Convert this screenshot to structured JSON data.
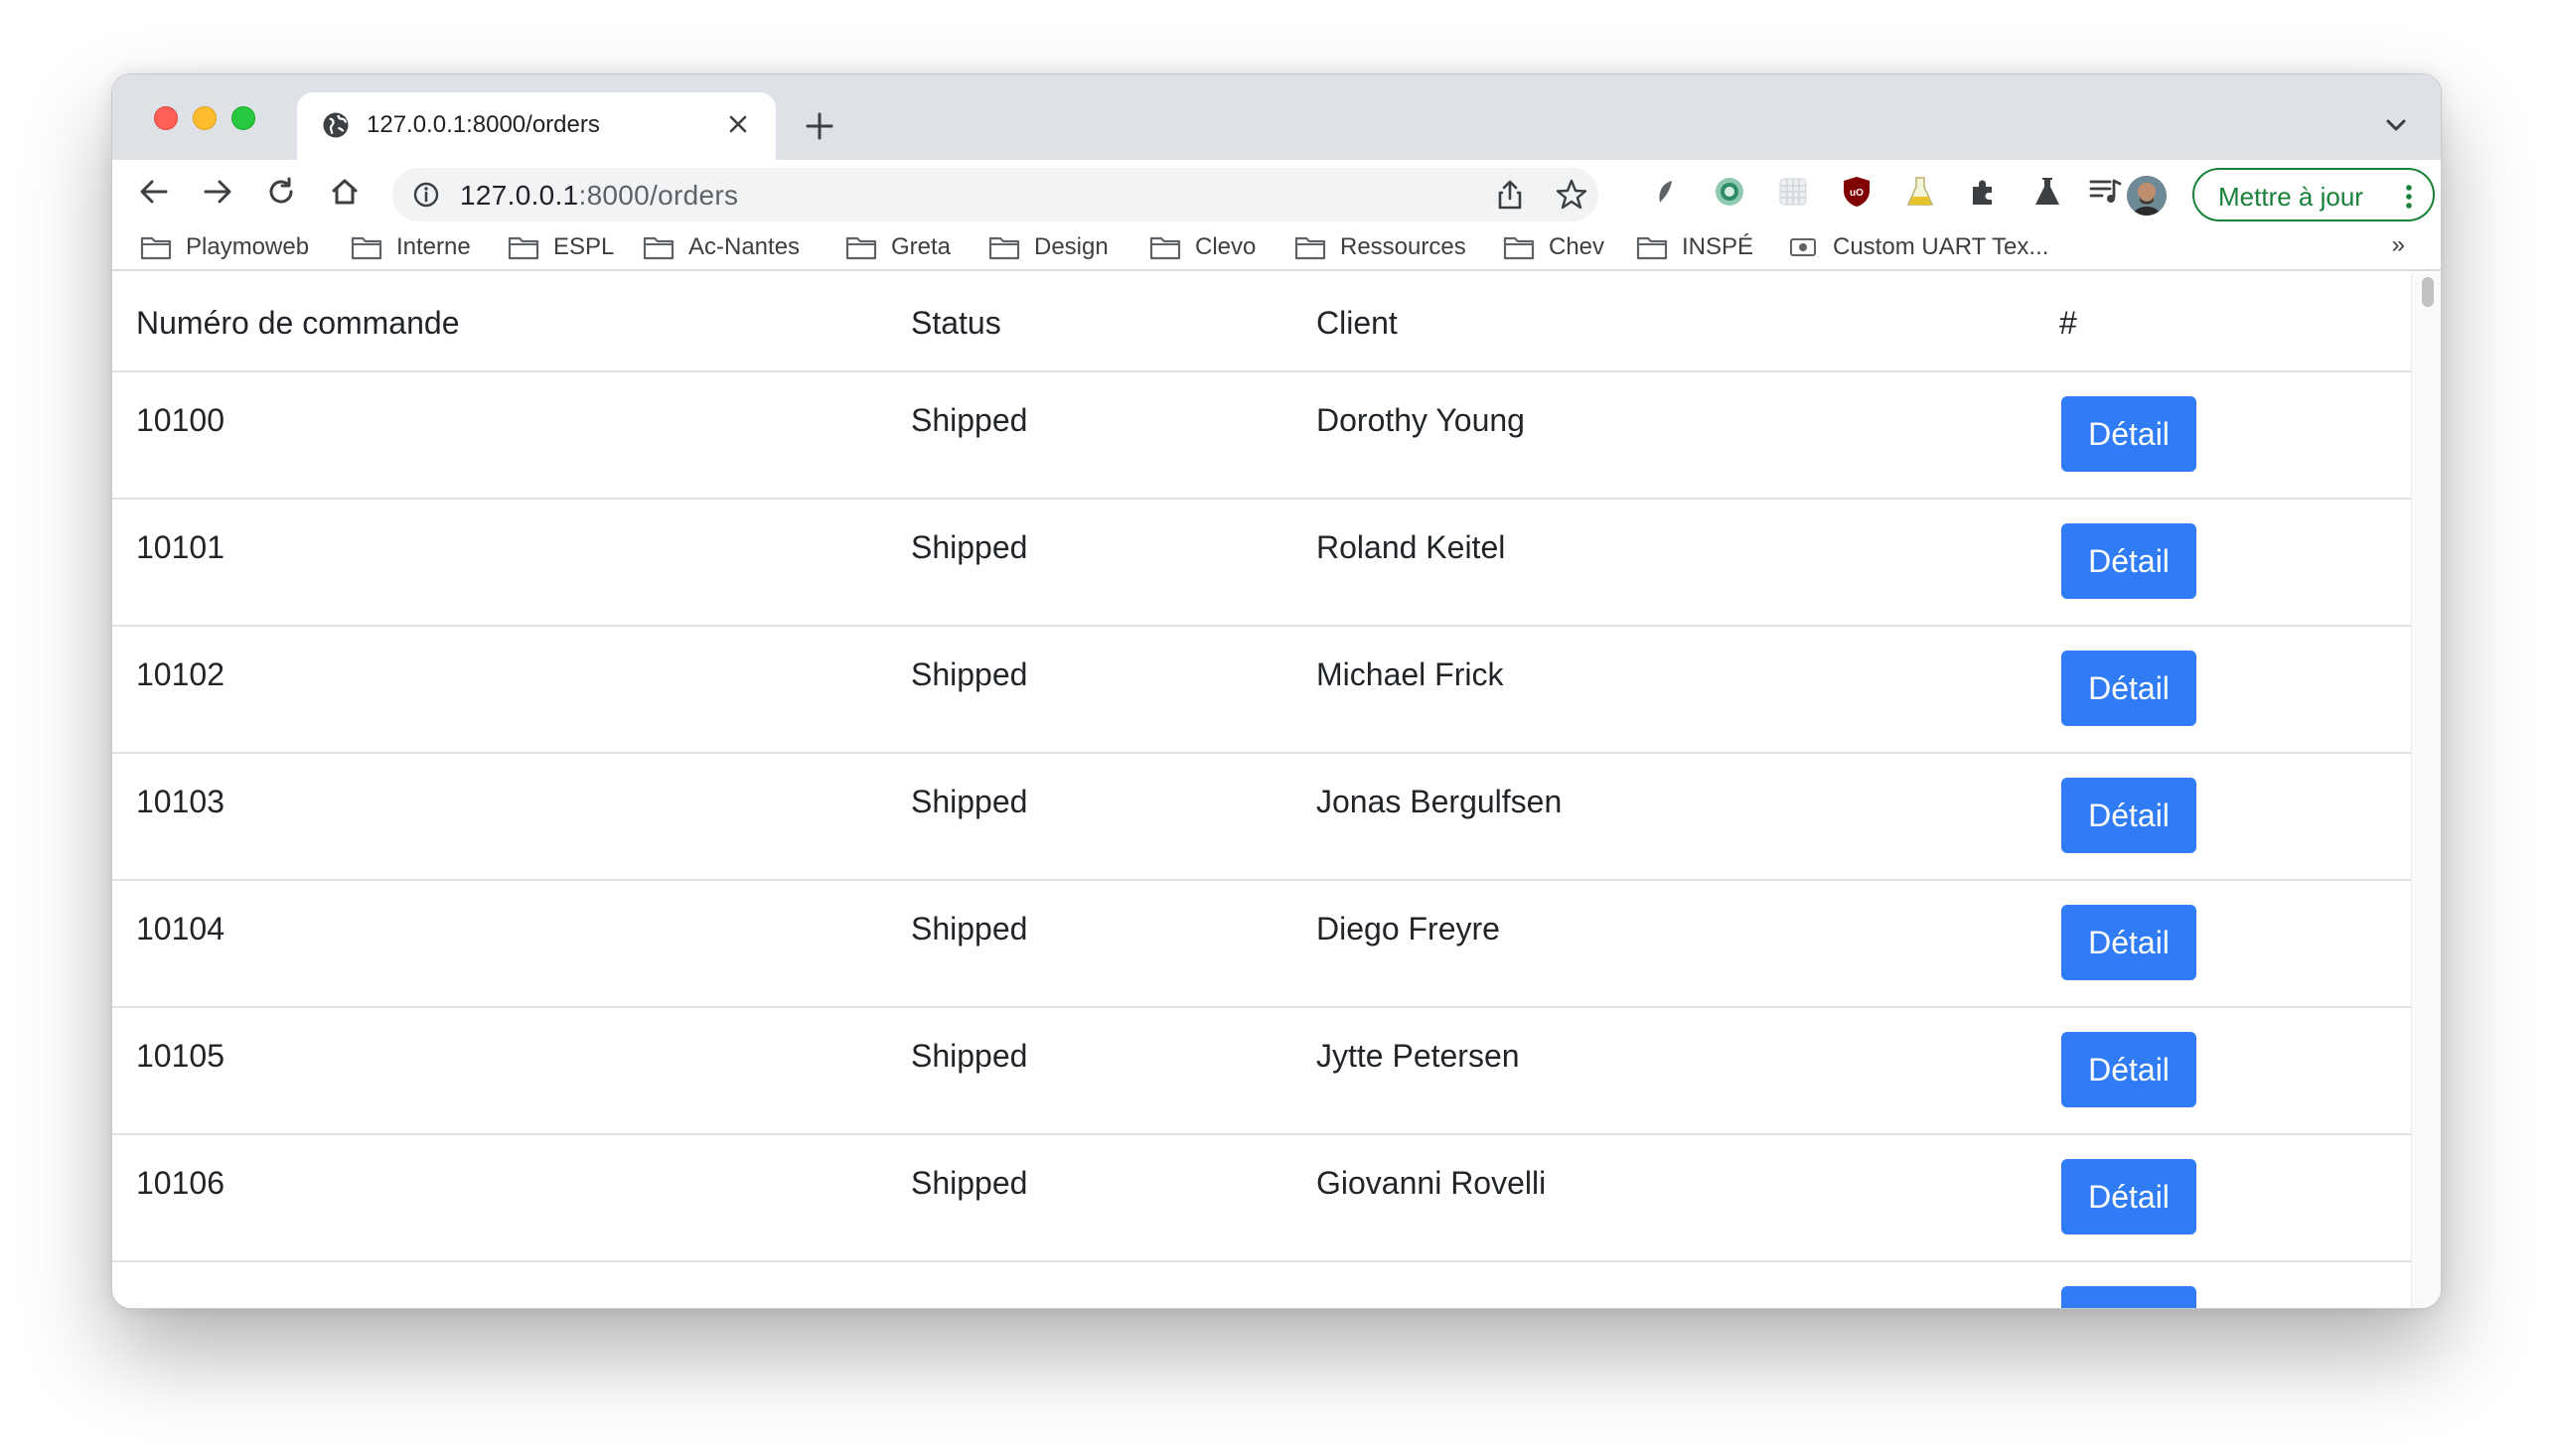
{
  "browser": {
    "tab_title": "127.0.0.1:8000/orders",
    "url_host": "127.0.0.1",
    "url_path": ":8000/orders",
    "update_label": "Mettre à jour",
    "accent_color": "#188038"
  },
  "bookmarks": {
    "items": [
      {
        "label": "Playmoweb",
        "icon": "folder-icon"
      },
      {
        "label": "Interne",
        "icon": "folder-icon"
      },
      {
        "label": "ESPL",
        "icon": "folder-icon"
      },
      {
        "label": "Ac-Nantes",
        "icon": "folder-icon"
      },
      {
        "label": "Greta",
        "icon": "folder-icon"
      },
      {
        "label": "Design",
        "icon": "folder-icon"
      },
      {
        "label": "Clevo",
        "icon": "folder-icon"
      },
      {
        "label": "Ressources",
        "icon": "folder-icon"
      },
      {
        "label": "Chev",
        "icon": "folder-icon"
      },
      {
        "label": "INSPÉ",
        "icon": "folder-icon"
      },
      {
        "label": "Custom UART Tex...",
        "icon": "page-icon"
      }
    ],
    "more": "»"
  },
  "table": {
    "headers": {
      "order": "Numéro de commande",
      "status": "Status",
      "client": "Client",
      "action": "#"
    },
    "rows": [
      {
        "order": "10100",
        "status": "Shipped",
        "client": "Dorothy Young",
        "action": "Détail"
      },
      {
        "order": "10101",
        "status": "Shipped",
        "client": "Roland Keitel",
        "action": "Détail"
      },
      {
        "order": "10102",
        "status": "Shipped",
        "client": "Michael Frick",
        "action": "Détail"
      },
      {
        "order": "10103",
        "status": "Shipped",
        "client": "Jonas Bergulfsen",
        "action": "Détail"
      },
      {
        "order": "10104",
        "status": "Shipped",
        "client": "Diego Freyre",
        "action": "Détail"
      },
      {
        "order": "10105",
        "status": "Shipped",
        "client": "Jytte Petersen",
        "action": "Détail"
      },
      {
        "order": "10106",
        "status": "Shipped",
        "client": "Giovanni Rovelli",
        "action": "Détail"
      }
    ],
    "button_color": "#2f7cf6"
  }
}
